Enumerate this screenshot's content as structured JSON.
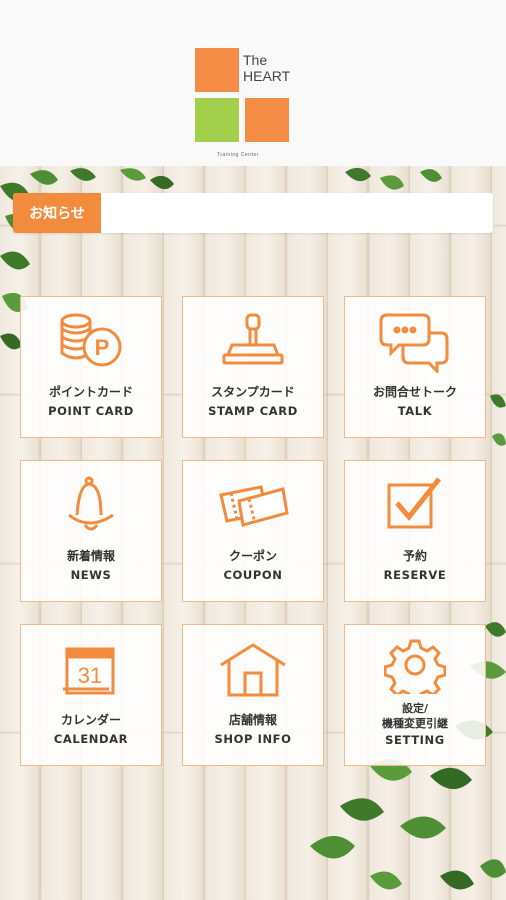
{
  "brand": {
    "name_line1": "The",
    "name_line2": "HEART",
    "tagline": "Training Center",
    "colors": {
      "orange": "#f58c45",
      "green": "#a4cf4d"
    }
  },
  "notice": {
    "label": "お知らせ",
    "text": ""
  },
  "menu": [
    {
      "jp": "ポイントカード",
      "en": "POINT CARD",
      "icon": "point-card-icon"
    },
    {
      "jp": "スタンプカード",
      "en": "STAMP CARD",
      "icon": "stamp-icon"
    },
    {
      "jp": "お問合せトーク",
      "en": "TALK",
      "icon": "chat-icon"
    },
    {
      "jp": "新着情報",
      "en": "NEWS",
      "icon": "bell-icon"
    },
    {
      "jp": "クーポン",
      "en": "COUPON",
      "icon": "coupon-icon"
    },
    {
      "jp": "予約",
      "en": "RESERVE",
      "icon": "checkbox-icon"
    },
    {
      "jp": "カレンダー",
      "en": "CALENDAR",
      "icon": "calendar-icon",
      "calendar_day": "31"
    },
    {
      "jp": "店舗情報",
      "en": "SHOP INFO",
      "icon": "house-icon"
    },
    {
      "jp": "設定/",
      "jp_line2": "機種変更引継",
      "en": "SETTING",
      "icon": "gear-icon"
    }
  ],
  "accent_color": "#f28c3c"
}
